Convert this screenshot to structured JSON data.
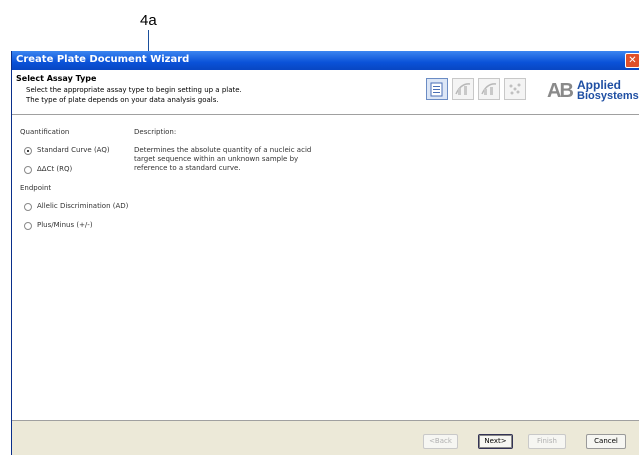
{
  "callouts": {
    "top": "4a"
  },
  "window": {
    "title": "Create Plate Document Wizard",
    "close_glyph": "✕"
  },
  "header": {
    "title": "Select Assay Type",
    "line1": "Select the appropriate assay type to begin setting up a plate.",
    "line2": "The type of plate depends on your data analysis goals.",
    "logo_mark": "AB",
    "logo_line1": "Applied",
    "logo_line2": "Biosystems",
    "icons": [
      "plate-document-icon",
      "assay-icon-1",
      "assay-icon-2",
      "assay-icon-3"
    ]
  },
  "assay": {
    "quantification_label": "Quantification",
    "endpoint_label": "Endpoint",
    "options": [
      {
        "label": "Standard Curve (AQ)",
        "selected": true
      },
      {
        "label": "ΔΔCt (RQ)",
        "selected": false
      },
      {
        "label": "Allelic Discrimination (AD)",
        "selected": false
      },
      {
        "label": "Plus/Minus (+/-)",
        "selected": false
      }
    ]
  },
  "description": {
    "label": "Description:",
    "line1": "Determines the absolute quantity of a nucleic acid",
    "line2": "target sequence within an unknown sample by",
    "line3": "reference to a standard curve."
  },
  "footer": {
    "back": "<Back",
    "next": "Next>",
    "finish": "Finish",
    "cancel": "Cancel"
  },
  "colors": {
    "titlebar": "#0a52d8",
    "callout_line": "#1a4f9c",
    "logo": "#1f4fa3"
  }
}
